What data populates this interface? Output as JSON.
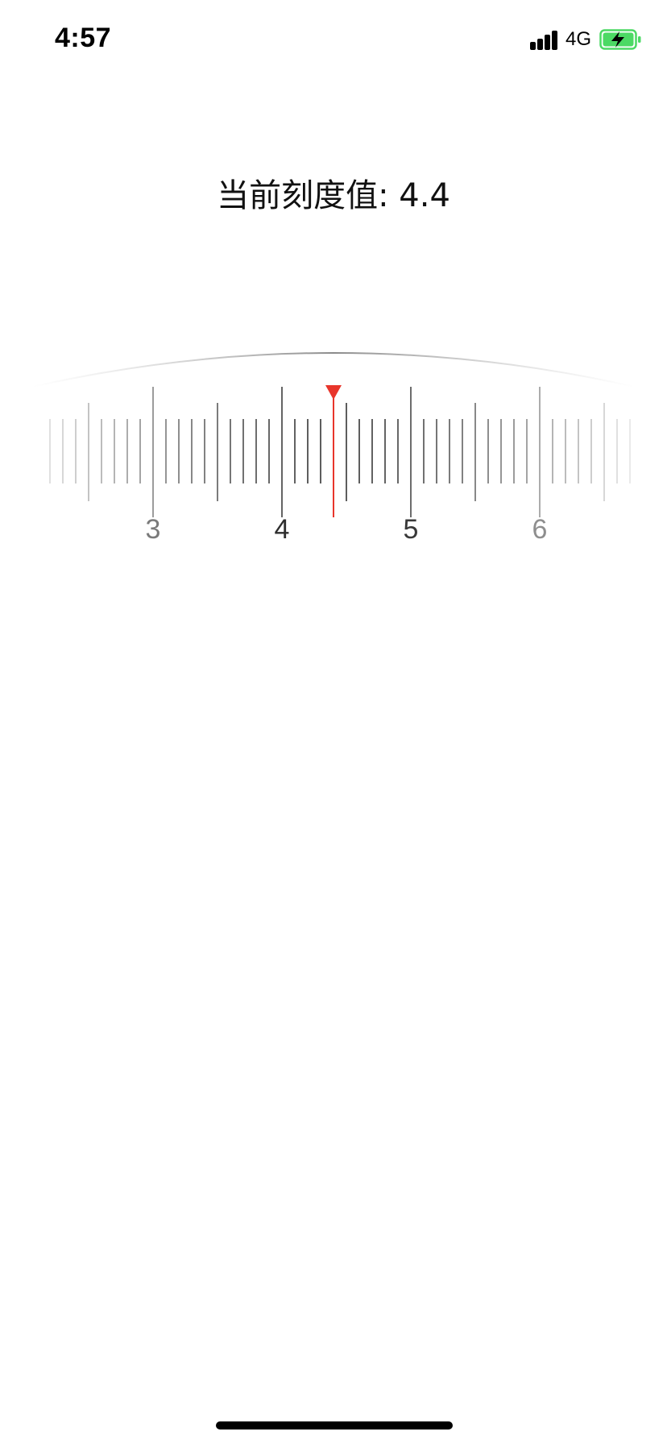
{
  "status_bar": {
    "time": "4:57",
    "network": "4G",
    "battery_state": "charging",
    "battery_color": "#4cd964"
  },
  "title": "当前刻度值: 4.4",
  "ruler": {
    "current_value": 4.4,
    "visible_labels": [
      "3",
      "4",
      "5",
      "6"
    ],
    "pointer_color": "#e8352b"
  }
}
